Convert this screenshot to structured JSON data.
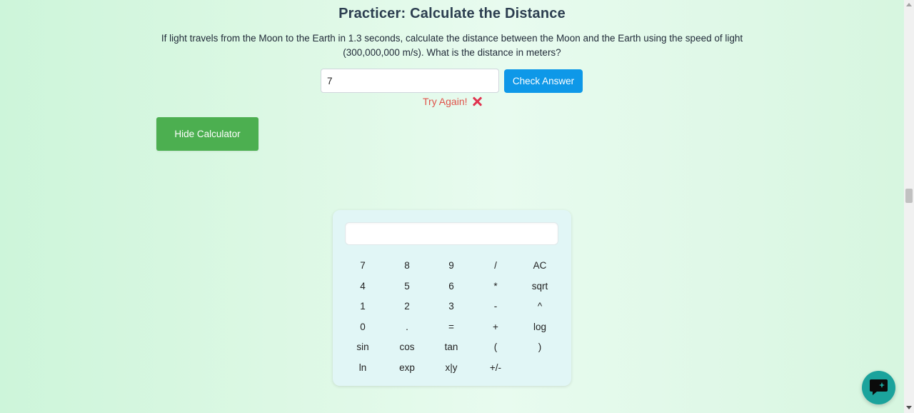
{
  "practice": {
    "title": "Practicer: Calculate the Distance",
    "question": "If light travels from the Moon to the Earth in 1.3 seconds, calculate the distance between the Moon and the Earth using the speed of light (300,000,000 m/s). What is the distance in meters?",
    "answer_value": "7",
    "check_label": "Check Answer",
    "feedback_text": "Try Again!",
    "feedback_icon": "cross-mark-icon"
  },
  "calculator": {
    "toggle_label": "Hide Calculator",
    "display_value": "",
    "keys": [
      [
        "7",
        "8",
        "9",
        "/",
        "AC"
      ],
      [
        "4",
        "5",
        "6",
        "*",
        "sqrt"
      ],
      [
        "1",
        "2",
        "3",
        "-",
        "^"
      ],
      [
        "0",
        ".",
        "=",
        "+",
        "log"
      ],
      [
        "sin",
        "cos",
        "tan",
        "(",
        ")"
      ],
      [
        "ln",
        "exp",
        "x|y",
        "+/-"
      ]
    ]
  },
  "chat": {
    "icon": "chat-bubble-icon"
  },
  "colors": {
    "check_button": "#0e98e8",
    "hide_button": "#4caf50",
    "error_text": "#e0524a",
    "chat_button": "#1ba39c",
    "calculator_bg": "#e1f6f6"
  }
}
